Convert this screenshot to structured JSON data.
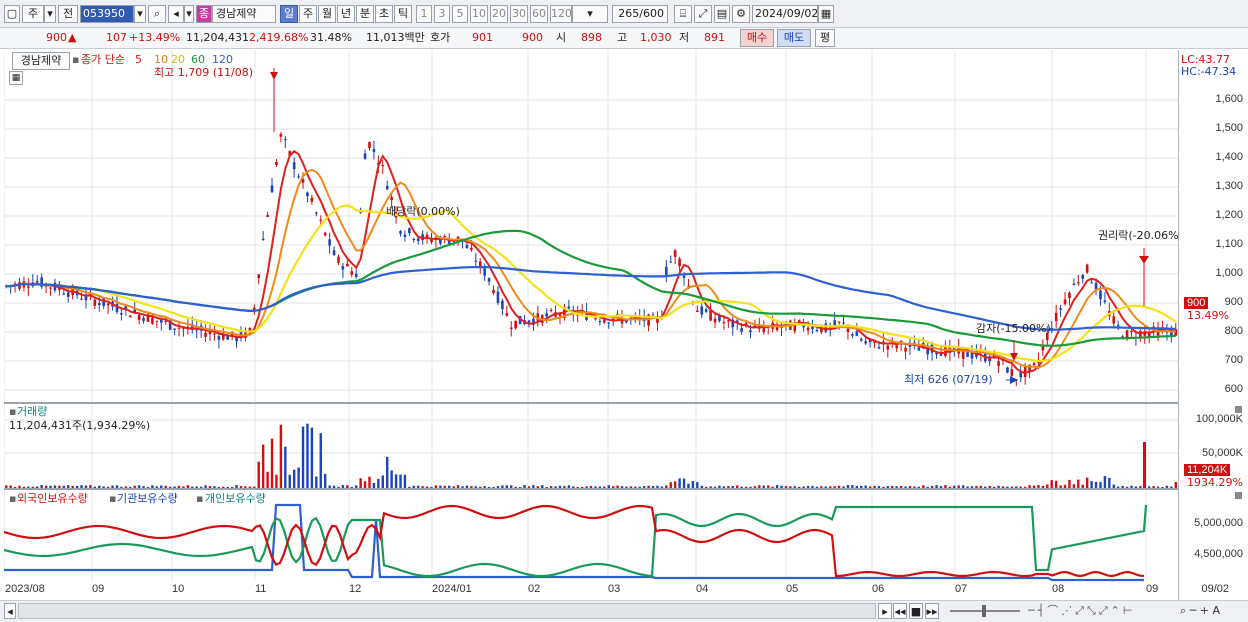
{
  "toolbar": {
    "period_main": "주",
    "compare_label": "전",
    "stock_code": "053950",
    "stock_badge": "종",
    "stock_name": "경남제약",
    "periods": [
      "일",
      "주",
      "월",
      "년",
      "분",
      "초",
      "틱"
    ],
    "active_period": "일",
    "intervals": [
      "1",
      "3",
      "5",
      "10",
      "20",
      "30",
      "60",
      "120"
    ],
    "count_display": "265",
    "count_total": "/600",
    "date_value": "2024/09/02"
  },
  "quote": {
    "price": "900",
    "change": "107",
    "change_pct": "+13.49%",
    "volume": "11,204,431",
    "volume_pct": "2,419.68%",
    "turnover": "31.48%",
    "amount": "11,013백만",
    "hoga_label": "호가",
    "ask": "901",
    "bid": "900",
    "open_label": "시",
    "open": "898",
    "high_label": "고",
    "high": "1,030",
    "low_label": "저",
    "low": "891",
    "buy_label": "매수",
    "sell_label": "매도",
    "eval_label": "평"
  },
  "price_panel": {
    "stock_label": "경남제약",
    "ma_label": "종가 단순",
    "ma_periods": [
      "5",
      "10",
      "20",
      "60",
      "120"
    ],
    "ma_colors": [
      "#e02020",
      "#f08a1a",
      "#f2e21a",
      "#1a9a3a",
      "#2f5fd0"
    ],
    "high_note": "최고 1,709 (11/08)",
    "low_note": "최저 626 (07/19)",
    "ann_dividend": "배당락(0.00%)",
    "ann_reduce": "감자(-15.00%)",
    "ann_rights": "권리락(-20.06%)",
    "lc": "LC:43.77",
    "hc": "HC:-47.34",
    "yticks": [
      "1,600",
      "1,500",
      "1,400",
      "1,300",
      "1,200",
      "1,100",
      "1,000",
      "900",
      "800",
      "700",
      "600"
    ],
    "price_tag": "900",
    "pct_tag": "13.49%"
  },
  "volume_panel": {
    "title": "거래량",
    "value_text": "11,204,431주(1,934.29%)",
    "yticks": [
      "100,000K",
      "50,000K"
    ],
    "vol_tag": "11,204K",
    "pct_tag": "1934.29%"
  },
  "holdings_panel": {
    "label_foreign": "외국인보유수량",
    "label_inst": "기관보유수량",
    "label_indiv": "개인보유수량",
    "yticks": [
      "5,000,000",
      "4,500,000"
    ]
  },
  "xaxis": [
    "2023/08",
    "09",
    "10",
    "11",
    "12",
    "2024/01",
    "02",
    "03",
    "04",
    "05",
    "06",
    "07",
    "08",
    "09"
  ],
  "xaxis_current": "09/02",
  "colors": {
    "up": "#d01010",
    "down": "#1a44b8",
    "accent": "#5b7ccf"
  }
}
